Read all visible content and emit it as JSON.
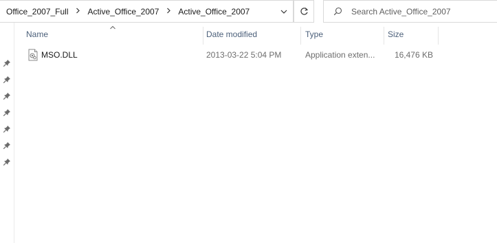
{
  "address_bar": {
    "breadcrumbs": [
      "Office_2007_Full",
      "Active_Office_2007",
      "Active_Office_2007"
    ]
  },
  "search": {
    "placeholder": "Search Active_Office_2007"
  },
  "columns": {
    "name": "Name",
    "date_modified": "Date modified",
    "type": "Type",
    "size": "Size",
    "sorted_by": "name"
  },
  "files": [
    {
      "name": "MSO.DLL",
      "date_modified": "2013-03-22 5:04 PM",
      "type": "Application exten...",
      "size": "16,476 KB",
      "icon": "dll-file-icon"
    }
  ],
  "nav_pane": {
    "pinned_count": 7
  },
  "icons": {
    "separator": "chevron-right-icon",
    "dropdown": "chevron-down-icon",
    "refresh": "refresh-icon",
    "search": "search-icon",
    "pin": "pin-icon"
  }
}
